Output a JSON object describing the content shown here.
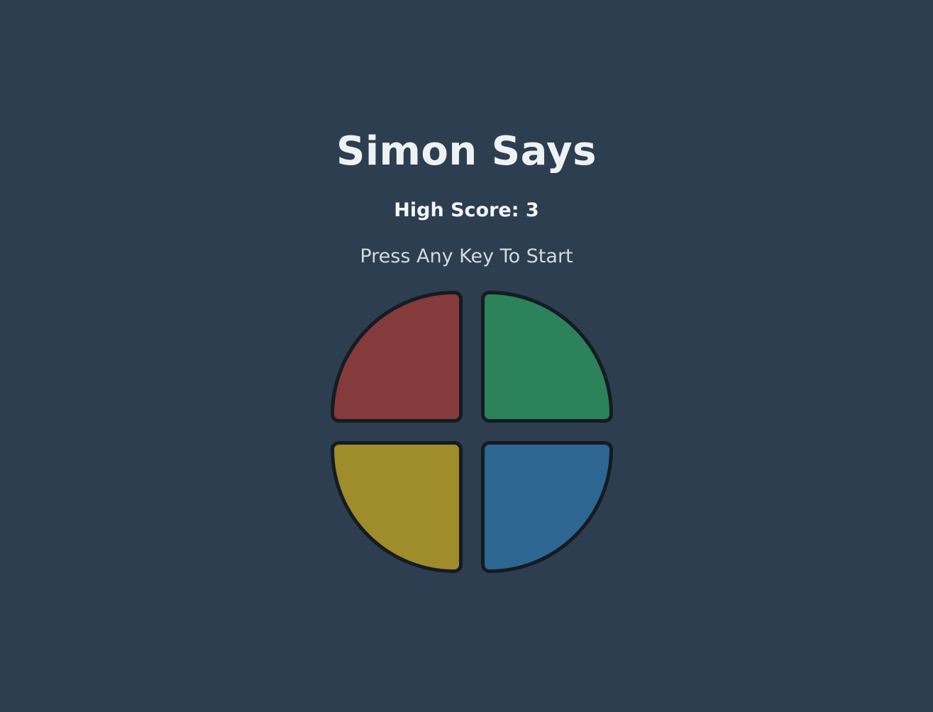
{
  "game": {
    "title": "Simon Says",
    "high_score": "High Score: 3",
    "status": "Press Any Key To Start"
  },
  "pads": [
    {
      "name": "red",
      "color": "#853b3b"
    },
    {
      "name": "green",
      "color": "#2b825b"
    },
    {
      "name": "yellow",
      "color": "#9f8c2a"
    },
    {
      "name": "blue",
      "color": "#2d6690"
    }
  ]
}
